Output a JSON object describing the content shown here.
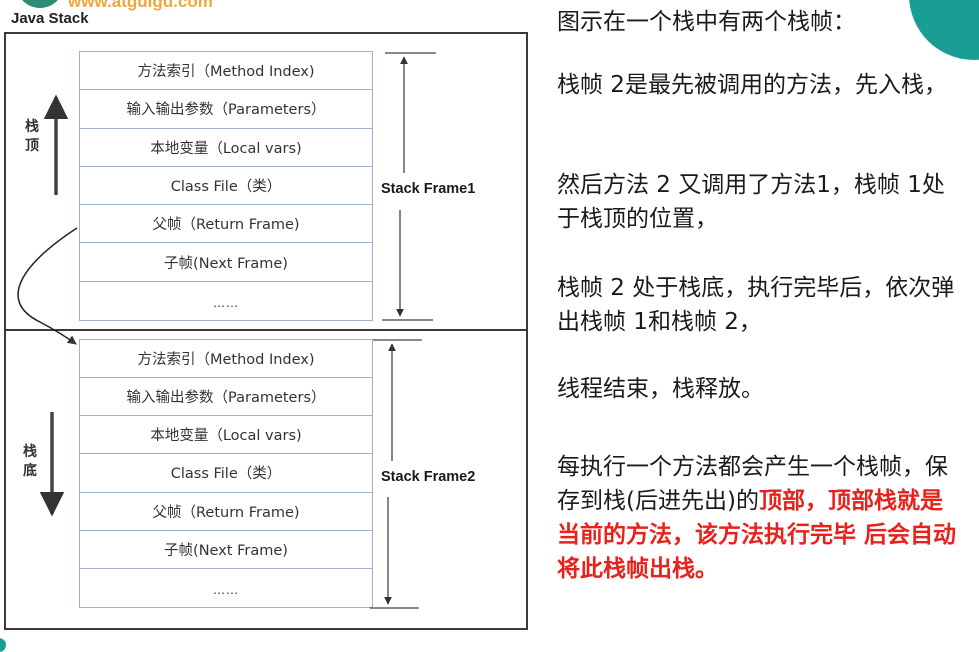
{
  "branding": {
    "url": "www.atguigu.com"
  },
  "diagram": {
    "title": "Java Stack",
    "top_side_label": "栈顶",
    "bottom_side_label": "栈底",
    "frames": [
      {
        "label": "Stack Frame1",
        "rows": [
          "方法索引（Method Index)",
          "输入输出参数（Parameters）",
          "本地变量（Local vars)",
          "Class File（类）",
          "父帧（Return Frame)",
          "子帧(Next Frame)",
          "……"
        ]
      },
      {
        "label": "Stack Frame2",
        "rows": [
          "方法索引（Method Index)",
          "输入输出参数（Parameters）",
          "本地变量（Local vars)",
          "Class File（类）",
          "父帧（Return Frame)",
          "子帧(Next Frame)",
          "……"
        ]
      }
    ]
  },
  "notes": {
    "p1": "图示在一个栈中有两个栈帧：",
    "p2": "栈帧 2是最先被调用的方法，先入栈，",
    "p3": "然后方法 2 又调用了方法1，栈帧 1处于栈顶的位置，",
    "p4": "栈帧 2 处于栈底，执行完毕后，依次弹出栈帧 1和栈帧 2，",
    "p5": "线程结束，栈释放。",
    "p6_normal": "每执行一个方法都会产生一个栈帧，保存到栈(后进先出)的",
    "p6_highlight": "顶部，顶部栈就是当前的方法，该方法执行完毕 后会自动将此栈帧出栈。"
  },
  "colors": {
    "highlight": "#e8221b",
    "accent_teal": "#1a9e94",
    "cell_border": "#9fb0d3",
    "url_orange": "#f3a53a"
  }
}
